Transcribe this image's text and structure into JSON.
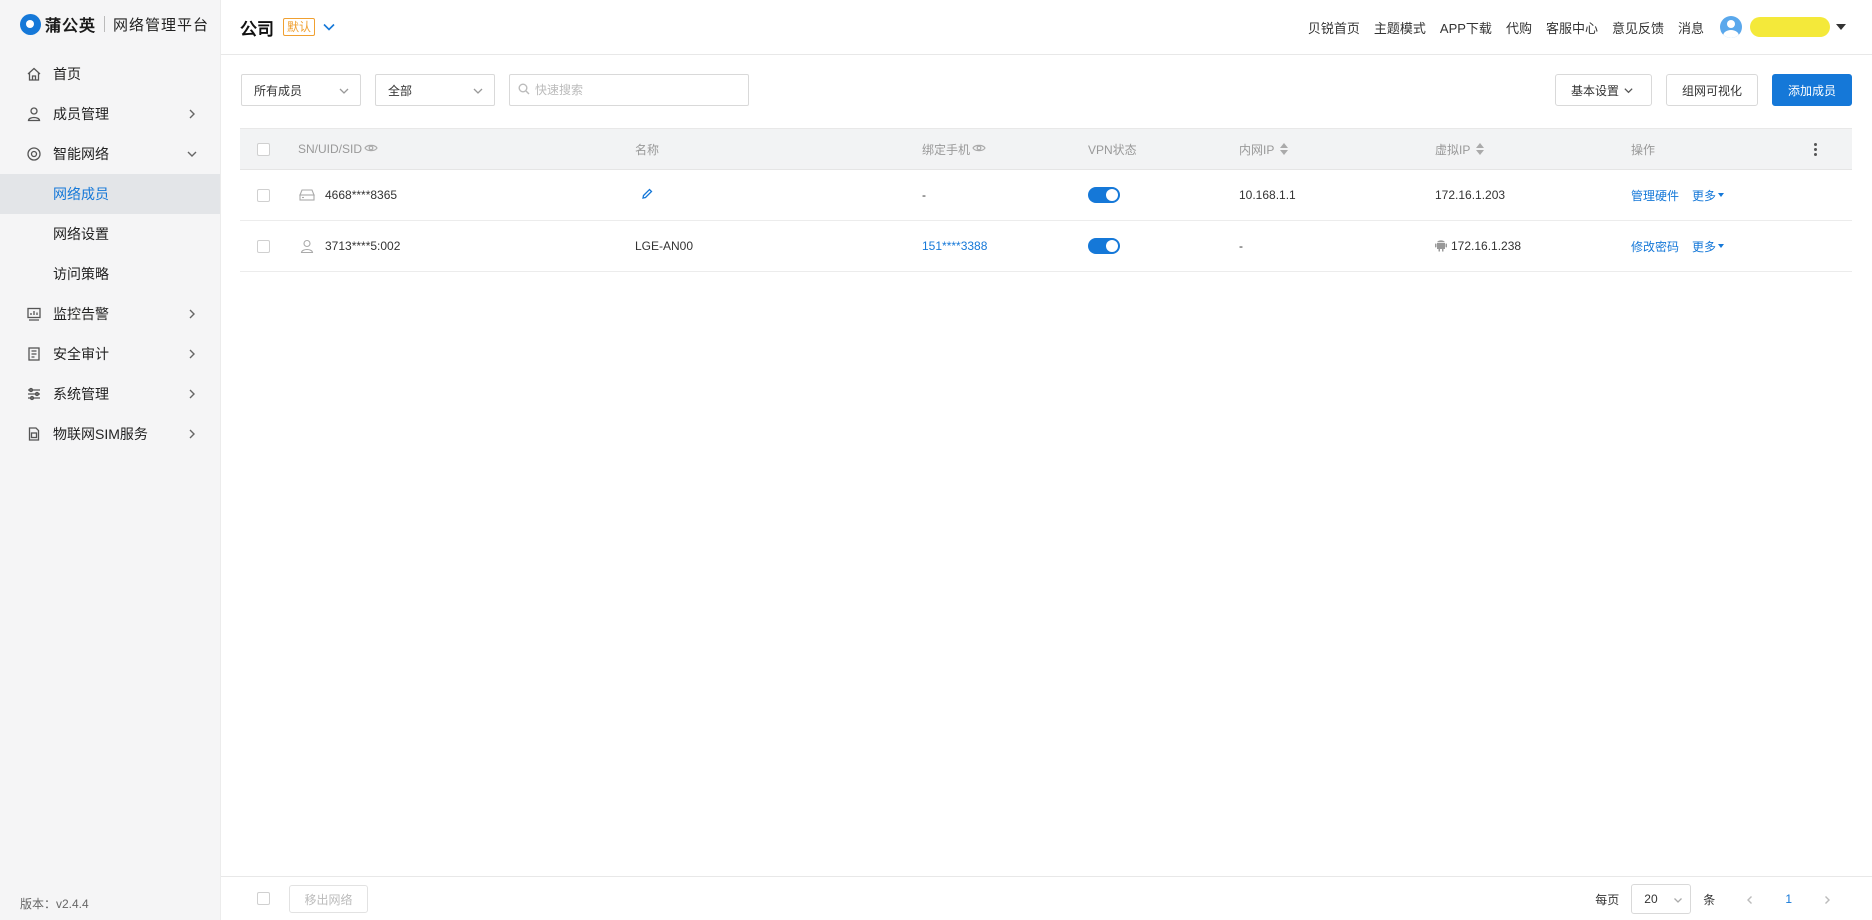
{
  "brand": {
    "name": "蒲公英",
    "platform": "网络管理平台"
  },
  "sidebar": {
    "items": [
      {
        "label": "首页",
        "icon": "home-icon"
      },
      {
        "label": "成员管理",
        "icon": "user-icon"
      },
      {
        "label": "智能网络",
        "icon": "network-icon"
      },
      {
        "label": "监控告警",
        "icon": "monitor-icon"
      },
      {
        "label": "安全审计",
        "icon": "audit-icon"
      },
      {
        "label": "系统管理",
        "icon": "settings-icon"
      },
      {
        "label": "物联网SIM服务",
        "icon": "sim-icon"
      }
    ],
    "subitems": [
      {
        "label": "网络成员",
        "active": true
      },
      {
        "label": "网络设置"
      },
      {
        "label": "访问策略"
      }
    ],
    "version": "版本：v2.4.4"
  },
  "topbar": {
    "company": "公司",
    "badge": "默认",
    "links": [
      "贝锐首页",
      "主题模式",
      "APP下载",
      "代购",
      "客服中心",
      "意见反馈",
      "消息"
    ]
  },
  "filters": {
    "member_type": "所有成员",
    "status": "全部",
    "search_placeholder": "快速搜索",
    "basic_settings": "基本设置",
    "visualize": "组网可视化",
    "add_member": "添加成员"
  },
  "table": {
    "headers": {
      "sn": "SN/UID/SID",
      "name": "名称",
      "phone": "绑定手机",
      "vpn": "VPN状态",
      "lan_ip": "内网IP",
      "virtual_ip": "虚拟IP",
      "ops": "操作"
    },
    "rows": [
      {
        "sn": "4668****8365",
        "name": "",
        "phone": "-",
        "vpn": true,
        "lan_ip": "10.168.1.1",
        "virtual_ip": "172.16.1.203",
        "op": "管理硬件",
        "more": "更多",
        "device": "router-icon"
      },
      {
        "sn": "3713****5:002",
        "name": "LGE-AN00",
        "phone": "151****3388",
        "vpn": true,
        "lan_ip": "-",
        "virtual_ip": "172.16.1.238",
        "op": "修改密码",
        "more": "更多",
        "device": "user-icon"
      }
    ]
  },
  "footer": {
    "remove": "移出网络",
    "per_page_label": "每页",
    "page_size": "20",
    "unit": "条",
    "current_page": "1"
  },
  "colors": {
    "accent": "#1578d8",
    "badge": "#f0a030"
  }
}
